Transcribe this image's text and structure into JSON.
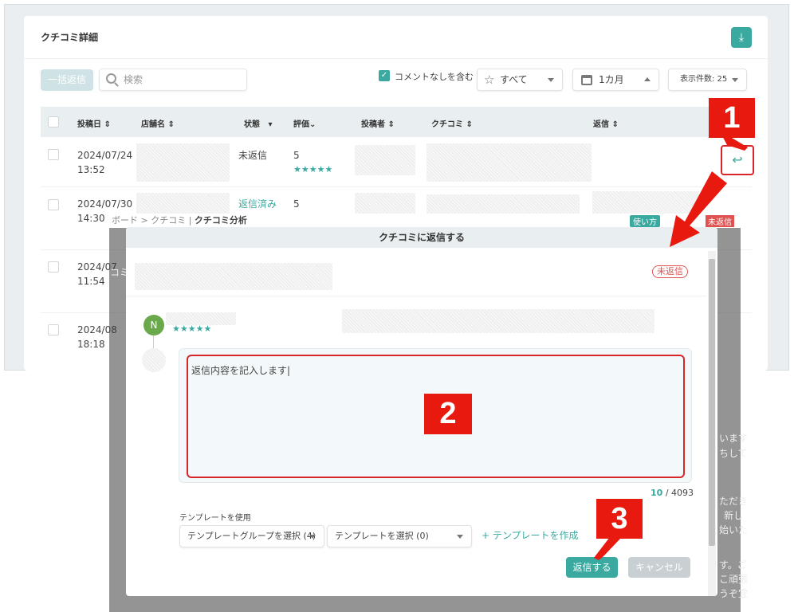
{
  "list": {
    "title": "クチコミ詳細",
    "bulk_reply": "一括返信",
    "search_placeholder": "検索",
    "no_comment_label": "コメントなしを含む",
    "rating_filter": "すべて",
    "period_filter": "1カ月",
    "page_size": "表示件数: 25",
    "columns": [
      "投稿日",
      "店舗名",
      "状態",
      "評価",
      "投稿者",
      "クチコミ",
      "返信"
    ],
    "rows": [
      {
        "date": "2024/07/24",
        "time": "13:52",
        "status": "未返信",
        "rating": "5",
        "stars": "★★★★★"
      },
      {
        "date": "2024/07/30",
        "time": "14:30",
        "status": "返信済み",
        "rating": "5",
        "stars": "★★★★★"
      },
      {
        "date": "2024/07",
        "time": "11:54"
      },
      {
        "date": "2024/08",
        "time": "18:18"
      }
    ]
  },
  "background_page": {
    "breadcrumb_1": "ボード",
    "breadcrumb_2": "クチコミ",
    "breadcrumb_3": "クチコミ分析",
    "help_label": "使い方",
    "tag_label": "未返信",
    "fragments": [
      "います",
      "ちして",
      "ただき",
      "新し",
      "始いた",
      "す。ご",
      "こ頑張",
      "うぞ宜",
      "コミ"
    ]
  },
  "modal": {
    "title": "クチコミに返信する",
    "status_tag": "未返信",
    "avatar_initial": "N",
    "stars": "★★★★★",
    "reply_placeholder": "返信内容を記入します",
    "char_count": "10",
    "char_max": "/ 4093",
    "template_label": "テンプレートを使用",
    "template_group_select": "テンプレートグループを選択 (4)",
    "template_select": "テンプレートを選択 (0)",
    "create_template": "+ テンプレートを作成",
    "reply_button": "返信する",
    "cancel_button": "キャンセル"
  },
  "annotations": {
    "step1": "1",
    "step2": "2",
    "step3": "3"
  },
  "colors": {
    "accent": "#3aa99f",
    "highlight": "#e8190f",
    "unreplied": "#e05252"
  }
}
